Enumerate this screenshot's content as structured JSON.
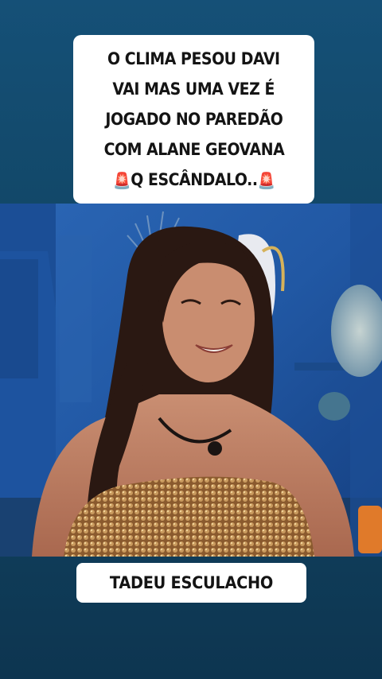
{
  "caption_top": {
    "lines": [
      "O CLIMA PESOU DAVI",
      "VAI MAS UMA VEZ É",
      "JOGADO NO PAREDÃO",
      "COM ALANE GEOVANA"
    ],
    "last_line_text": "Q ESCÂNDALO..",
    "last_line_emoji_left": "🚨",
    "last_line_emoji_right": "🚨"
  },
  "caption_bottom": {
    "text": "TADEU ESCULACHO"
  },
  "colors": {
    "background": "#124869",
    "video_backdrop": "#1f5a9c",
    "dress": "#b07a43",
    "caption_bg": "#ffffff",
    "caption_text": "#141414"
  }
}
